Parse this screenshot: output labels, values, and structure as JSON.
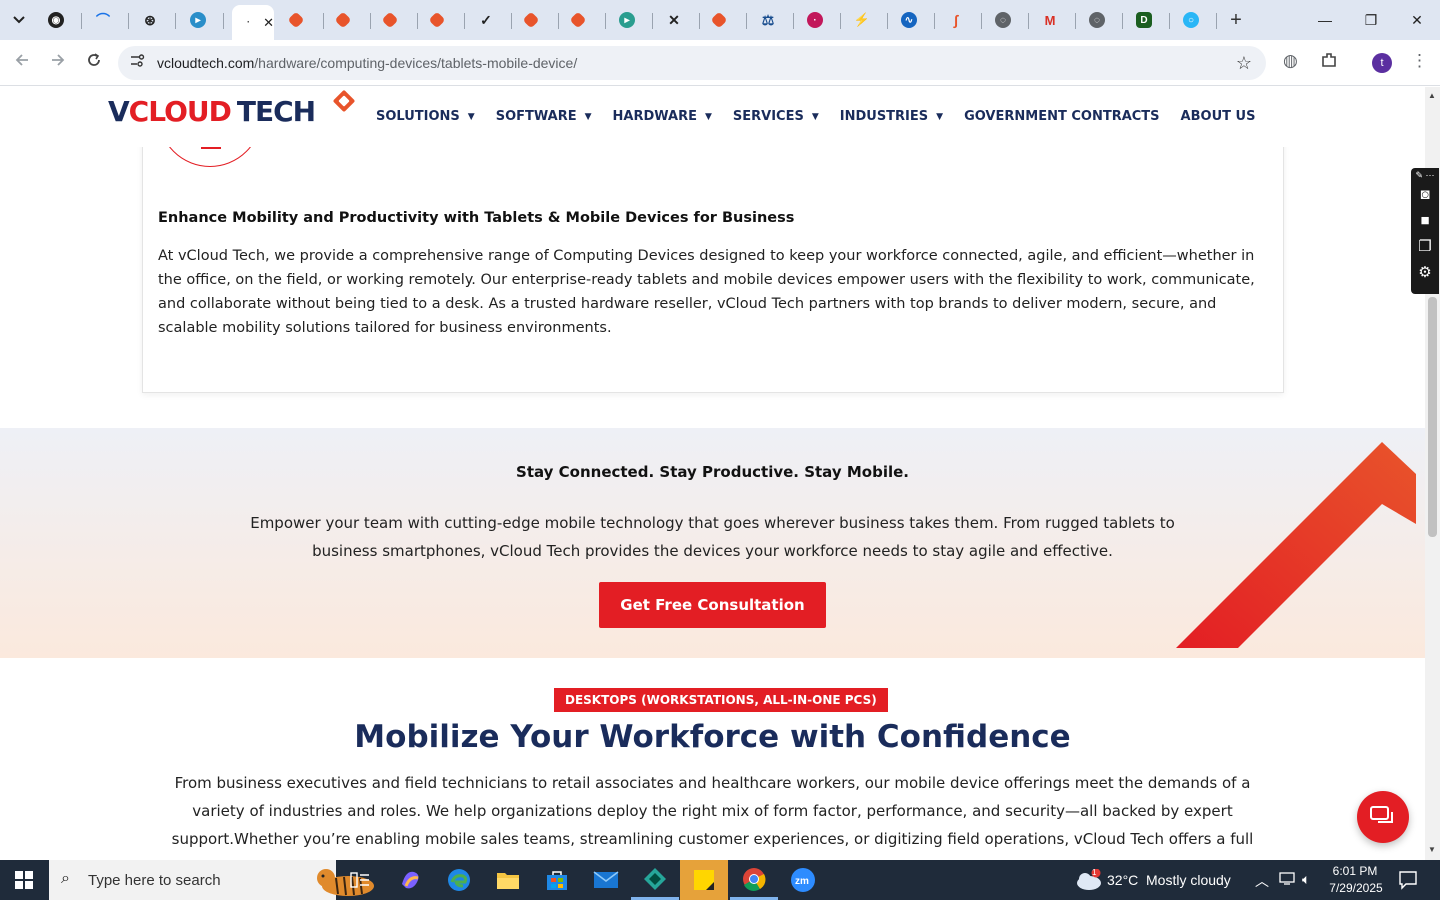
{
  "browser": {
    "active_tab_close": "✕",
    "new_tab_label": "+",
    "url_host": "vcloudtech.com",
    "url_path": "/hardware/computing-devices/tablets-mobile-device/",
    "profile_initial": "t",
    "window_controls": {
      "minimize": "—",
      "restore": "❐",
      "close": "✕"
    }
  },
  "site": {
    "logo": {
      "v": "V",
      "cloud": "CLOUD",
      "tech": "TECH"
    },
    "nav": [
      {
        "label": "SOLUTIONS",
        "caret": "▼"
      },
      {
        "label": "SOFTWARE",
        "caret": "▼"
      },
      {
        "label": "HARDWARE",
        "caret": "▼"
      },
      {
        "label": "SERVICES",
        "caret": "▼"
      },
      {
        "label": "INDUSTRIES",
        "caret": "▼"
      },
      {
        "label": "GOVERNMENT CONTRACTS",
        "caret": ""
      },
      {
        "label": "ABOUT US",
        "caret": ""
      }
    ]
  },
  "intro": {
    "title": "Enhance Mobility and Productivity with Tablets & Mobile Devices for Business",
    "body": "At vCloud Tech, we provide a comprehensive range of Computing Devices designed to keep your workforce connected, agile, and efficient—whether in the office, on the field, or working remotely. Our enterprise-ready tablets and mobile devices empower users with the flexibility to work, communicate, and collaborate without being tied to a desk. As a trusted hardware reseller, vCloud Tech partners with top brands to deliver modern, secure, and scalable mobility solutions tailored for business environments."
  },
  "cta": {
    "title": "Stay Connected. Stay Productive. Stay Mobile.",
    "body": "Empower your team with cutting-edge mobile technology that goes wherever business takes them. From rugged tablets to business smartphones, vCloud Tech provides the devices your workforce needs to stay agile and effective.",
    "button": "Get Free Consultation"
  },
  "section": {
    "badge": "DESKTOPS (WORKSTATIONS, ALL-IN-ONE PCS)",
    "title": "Mobilize Your Workforce with Confidence",
    "body": "From business executives and field technicians to retail associates and healthcare workers, our mobile device offerings meet the demands of a variety of industries and roles. We help organizations deploy the right mix of form factor, performance, and security—all backed by expert support.Whether you’re enabling mobile sales teams, streamlining customer experiences, or digitizing field operations, vCloud Tech offers a full"
  },
  "taskbar": {
    "search_placeholder": "Type here to search",
    "weather_temp": "32°C",
    "weather_desc": "Mostly cloudy",
    "weather_badge": "1",
    "time": "6:01 PM",
    "date": "7/29/2025"
  },
  "colors": {
    "brand_red": "#e31e24",
    "brand_navy": "#1a2c5b",
    "taskbar": "#1f2b3a"
  }
}
